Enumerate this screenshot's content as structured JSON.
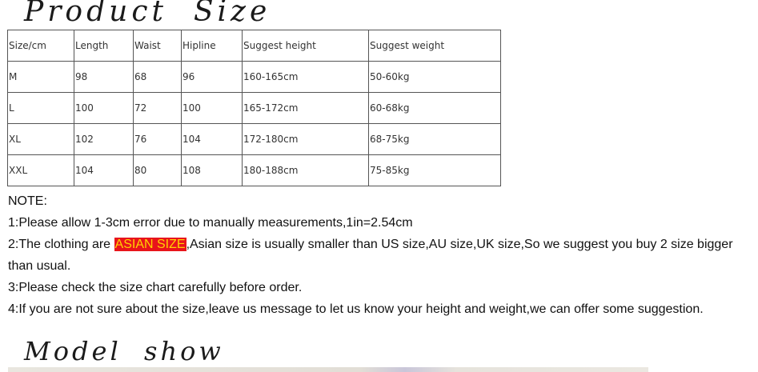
{
  "titles": {
    "product_size": "Product  Size",
    "model_show": "Model  show"
  },
  "table": {
    "headers": [
      "Size/cm",
      "Length",
      "Waist",
      "Hipline",
      "Suggest height",
      "Suggest weight"
    ],
    "rows": [
      [
        "M",
        "98",
        "68",
        "96",
        "160-165cm",
        "50-60kg"
      ],
      [
        "L",
        "100",
        "72",
        "100",
        "165-172cm",
        "60-68kg"
      ],
      [
        "XL",
        "102",
        "76",
        "104",
        "172-180cm",
        "68-75kg"
      ],
      [
        "XXL",
        "104",
        "80",
        "108",
        "180-188cm",
        "75-85kg"
      ]
    ]
  },
  "notes": {
    "heading": "NOTE:",
    "n1": "1:Please allow 1-3cm error due to manually measurements,1in=2.54cm",
    "n2_pre": "2:The clothing are ",
    "n2_highlight": "ASIAN SIZE",
    "n2_post": ",Asian size is usually smaller than US size,AU size,UK size,So we suggest you buy 2 size bigger than  usual.",
    "n3": "3:Please check the size chart carefully before order.",
    "n4": "4:If you are not sure about the size,leave us message to let us know your height and weight,we can offer some suggestion."
  },
  "colors": {
    "highlight_bg": "#e8141b",
    "highlight_text": "#ffd200"
  }
}
